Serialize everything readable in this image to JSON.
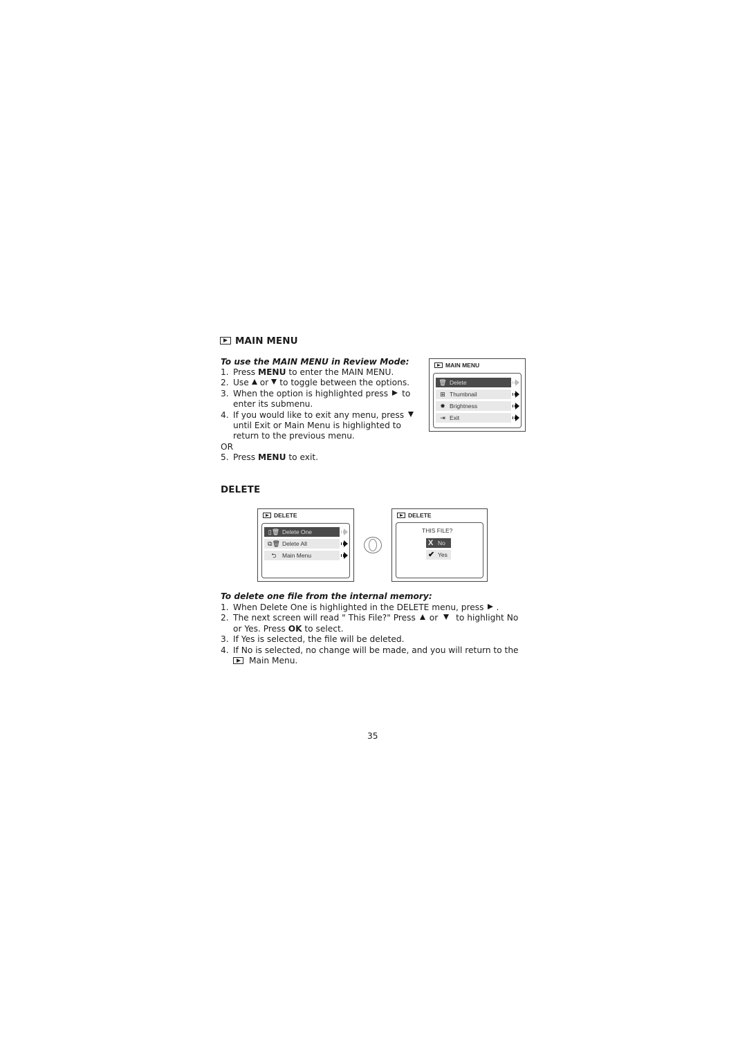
{
  "main_menu_section": {
    "title": "MAIN MENU",
    "subtitle": "To use the MAIN MENU in Review Mode:",
    "steps": [
      {
        "num": "1.",
        "pre": "Press ",
        "bold": "MENU",
        "post": " to enter the MAIN MENU."
      },
      {
        "num": "2.",
        "pre": "Use",
        "mid": "or",
        "post": "to toggle between the options."
      },
      {
        "num": "3.",
        "pre": "When the option is highlighted press",
        "post": "to",
        "cont": "enter its submenu."
      },
      {
        "num": "4.",
        "pre": "If you would like to exit any menu, press",
        "cont1": "until Exit or Main Menu is highlighted to",
        "cont2": "return to the previous menu."
      },
      {
        "num": "5.",
        "pre": "Press ",
        "bold": "MENU",
        "post": " to exit."
      }
    ],
    "or_label": "OR",
    "screen": {
      "title": "MAIN MENU",
      "items": [
        {
          "label": "Delete",
          "icon": "trash-icon",
          "selected": true
        },
        {
          "label": "Thumbnail",
          "icon": "grid-icon",
          "selected": false
        },
        {
          "label": "Brightness",
          "icon": "sun-icon",
          "selected": false
        },
        {
          "label": "Exit",
          "icon": "exit-door-icon",
          "selected": false
        }
      ]
    }
  },
  "delete_section": {
    "title": "DELETE",
    "screen_menu": {
      "title": "DELETE",
      "items": [
        {
          "label": "Delete One",
          "icon": "delete-one-icon",
          "selected": true
        },
        {
          "label": "Delete All",
          "icon": "delete-all-icon",
          "selected": false
        },
        {
          "label": "Main Menu",
          "icon": "return-arrow-icon",
          "selected": false
        }
      ]
    },
    "screen_confirm": {
      "title": "DELETE",
      "question": "THIS FILE?",
      "choices": [
        {
          "label": "No",
          "icon": "x-icon",
          "glyph": "X",
          "selected": true
        },
        {
          "label": "Yes",
          "icon": "check-icon",
          "glyph": "✔",
          "selected": false
        }
      ]
    },
    "subtitle": "To delete one file from the internal memory:",
    "steps": [
      {
        "num": "1.",
        "pre": "When Delete One is highlighted in the DELETE menu, press",
        "post": "."
      },
      {
        "num": "2.",
        "pre": "The next screen will read \" This File?\" Press",
        "mid": "or",
        "post": " to highlight No",
        "cont_pre": "or Yes. Press ",
        "cont_bold": "OK",
        "cont_post": " to select."
      },
      {
        "num": "3.",
        "text": "If Yes is selected, the file will be deleted."
      },
      {
        "num": "4.",
        "text": "If No is selected, no change will be made, and you will return to the",
        "cont": "Main Menu."
      }
    ]
  },
  "page_number": "35"
}
